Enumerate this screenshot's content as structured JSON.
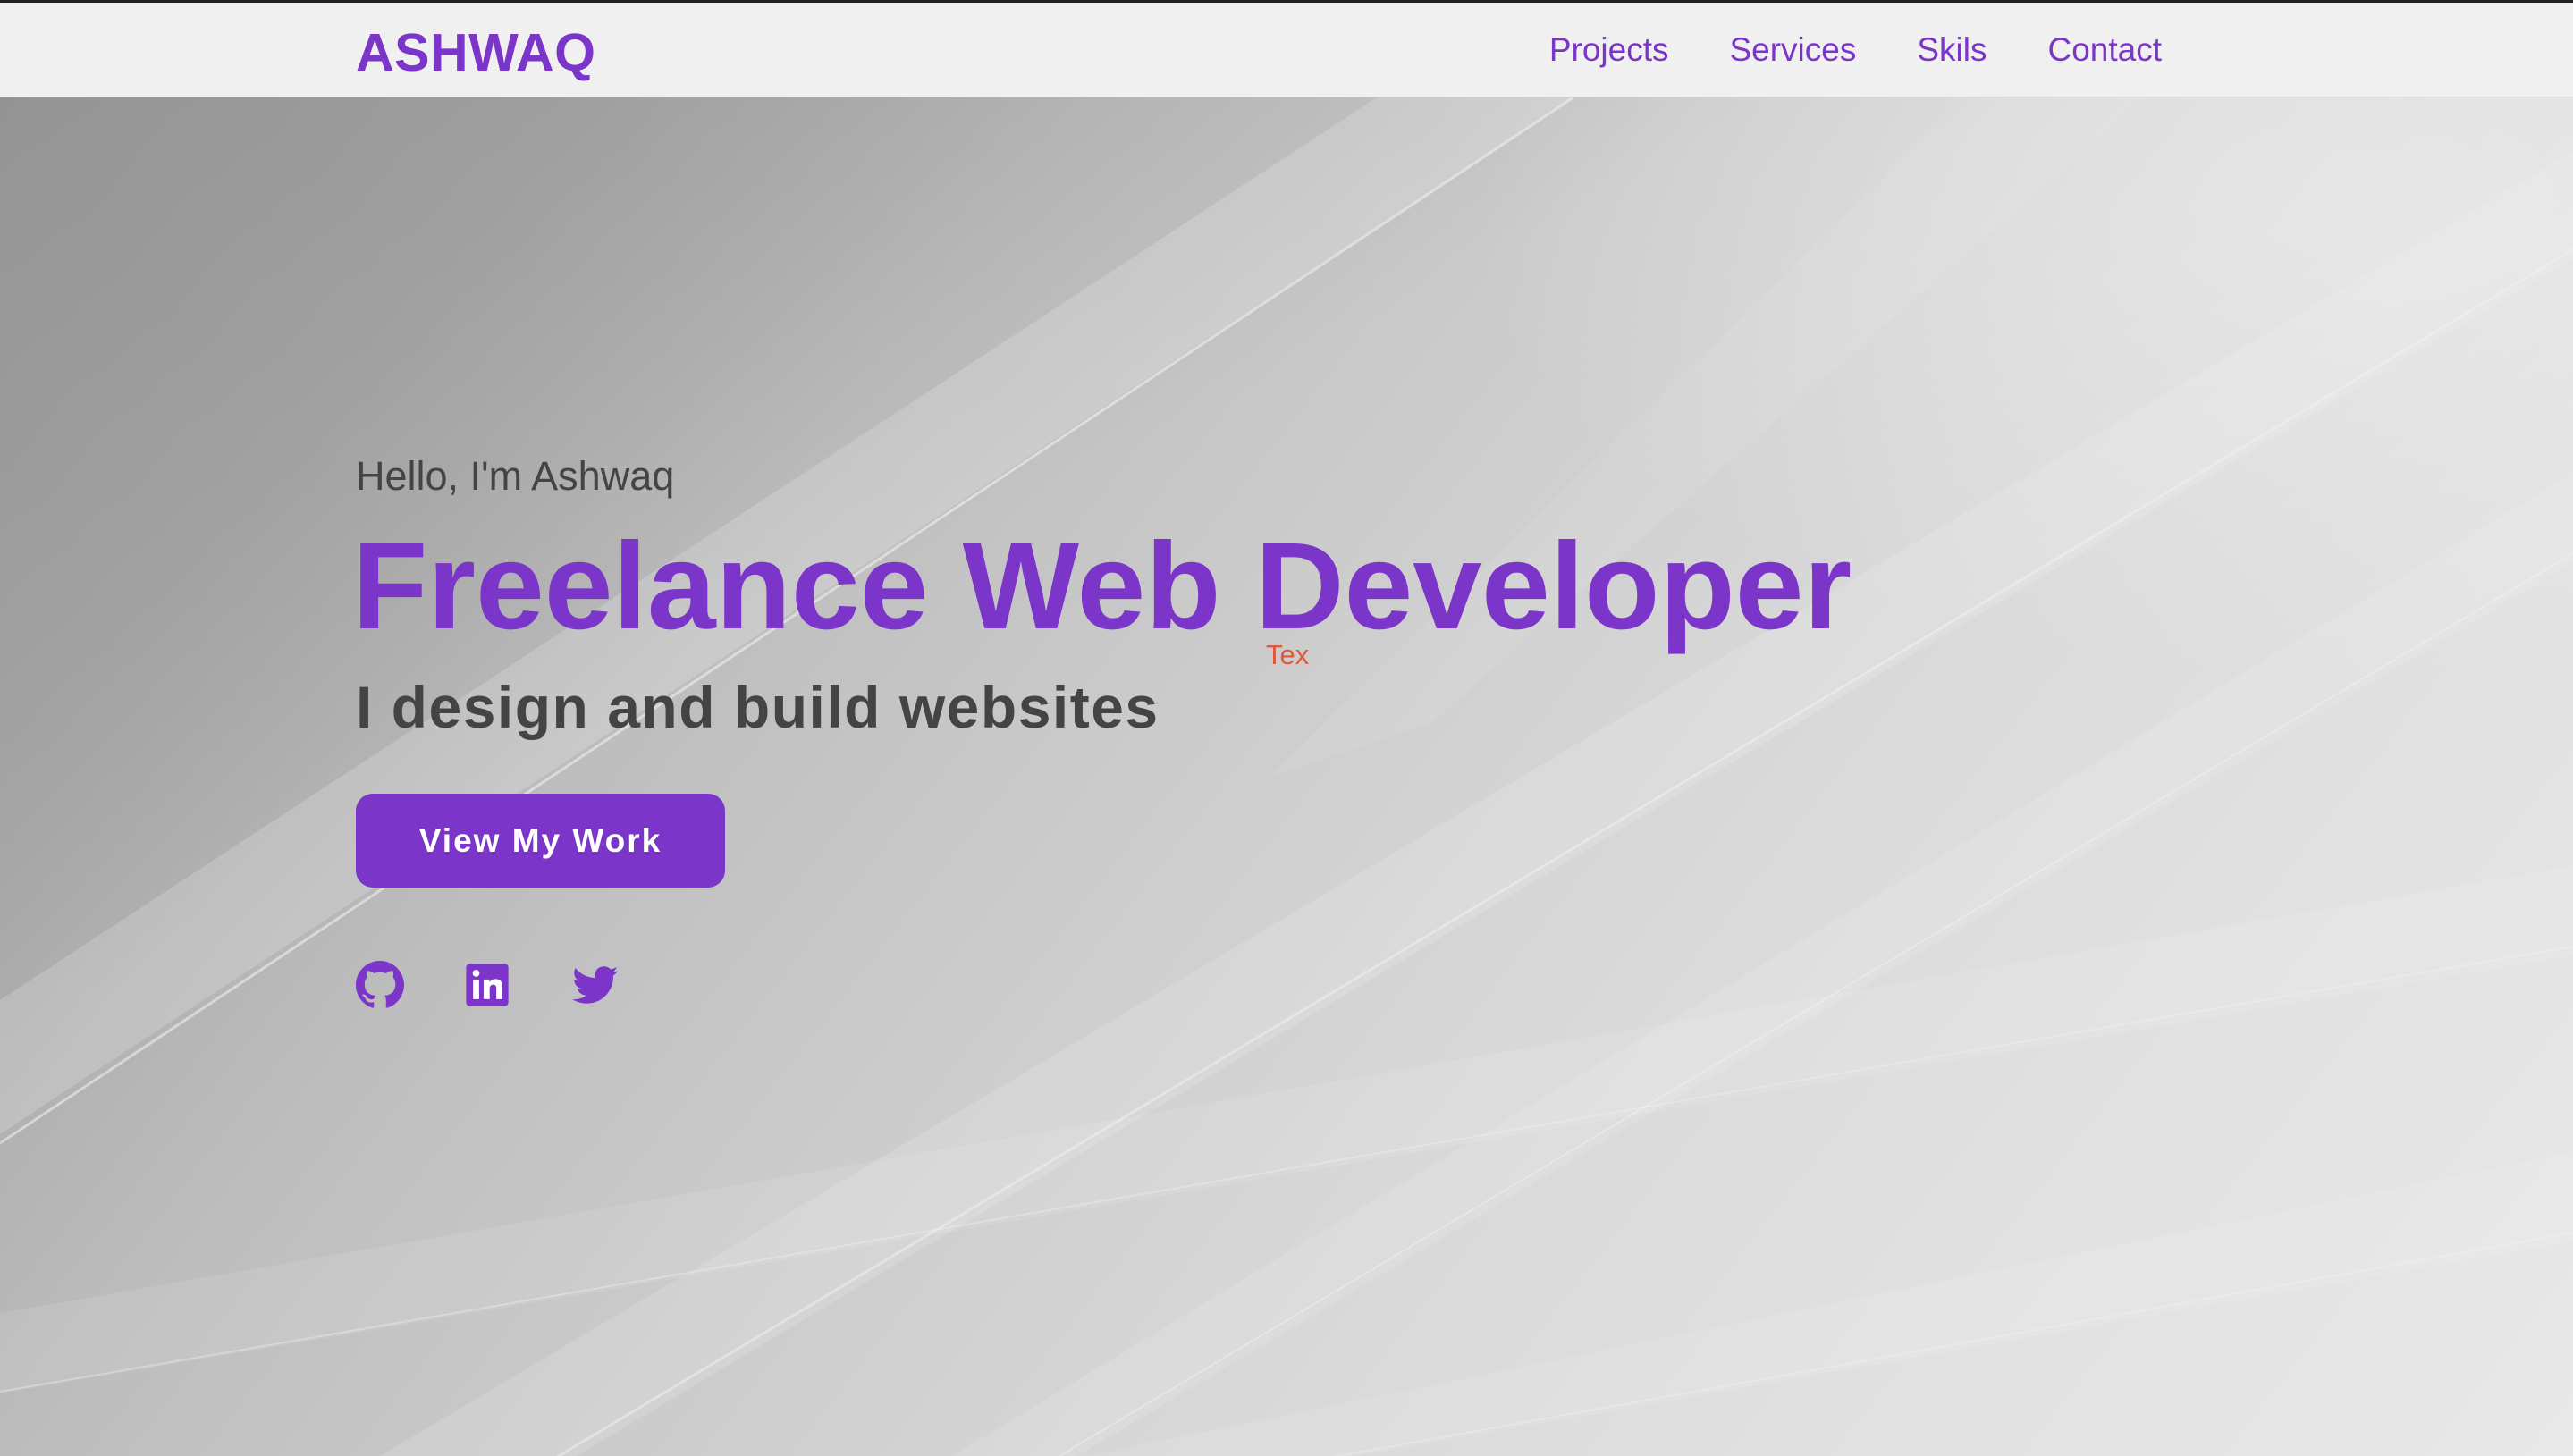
{
  "navbar": {
    "logo": "ASHWAQ",
    "links": [
      {
        "label": "Projects"
      },
      {
        "label": "Services"
      },
      {
        "label": "Skils"
      },
      {
        "label": "Contact"
      }
    ]
  },
  "hero": {
    "greeting": "Hello, I'm Ashwaq",
    "headline": "Freelance Web Developer",
    "stray_text": "Tex",
    "tagline": "I design and build websites",
    "cta_label": "View My Work",
    "socials": [
      {
        "icon": "github-icon"
      },
      {
        "icon": "linkedin-icon"
      },
      {
        "icon": "twitter-icon"
      }
    ]
  },
  "colors": {
    "accent": "#7b35c9",
    "text_dark": "#444444",
    "stray_text": "#e0573c",
    "navbar_bg": "#f0f0f0"
  }
}
